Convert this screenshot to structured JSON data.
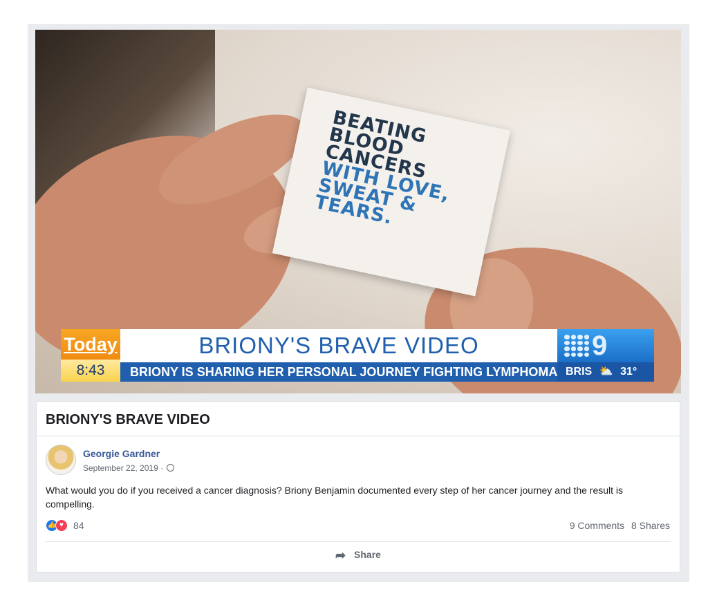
{
  "video": {
    "card_text_dark": [
      "BEATING",
      "BLOOD",
      "CANCERS"
    ],
    "card_text_blue": [
      "WITH LOVE,",
      "SWEAT &",
      "TEARS."
    ],
    "lower_third": {
      "logo": "Today",
      "time": "8:43",
      "title": "BRIONY'S BRAVE VIDEO",
      "subtitle": "BRIONY IS SHARING HER PERSONAL JOURNEY FIGHTING LYMPHOMA",
      "network_logo": "9",
      "weather_city": "BRIS",
      "weather_icon": "cloud-sun-icon",
      "temperature": "31°"
    }
  },
  "post": {
    "title": "BRIONY'S BRAVE VIDEO",
    "author": "Georgie Gardner",
    "date": "September 22, 2019 ·",
    "privacy_icon": "globe-icon",
    "text": "What would you do if you received a cancer diagnosis? Briony Benjamin documented every step of her cancer journey and the result is compelling.",
    "reaction_count": "84",
    "comments": "9 Comments",
    "shares": "8 Shares",
    "share_label": "Share"
  },
  "colors": {
    "link_blue": "#385898",
    "fb_blue": "#1877f2",
    "love_red": "#f33e58",
    "nine_blue": "#1f5fad",
    "today_orange": "#f7a623"
  }
}
